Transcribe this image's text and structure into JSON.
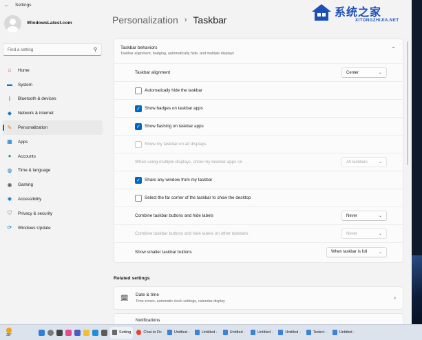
{
  "window": {
    "title": "Settings"
  },
  "profile": {
    "name": "WindowsLatest.com",
    "subtitle": ""
  },
  "search": {
    "placeholder": "Find a setting"
  },
  "nav": [
    {
      "label": "Home",
      "icon": "home-icon",
      "color": "#c0392b"
    },
    {
      "label": "System",
      "icon": "system-icon",
      "color": "#0078d4"
    },
    {
      "label": "Bluetooth & devices",
      "icon": "bluetooth-icon",
      "color": "#0078d4"
    },
    {
      "label": "Network & internet",
      "icon": "wifi-icon",
      "color": "#0078d4"
    },
    {
      "label": "Personalization",
      "icon": "brush-icon",
      "color": "#e07a14",
      "active": true
    },
    {
      "label": "Apps",
      "icon": "apps-icon",
      "color": "#0078d4"
    },
    {
      "label": "Accounts",
      "icon": "person-icon",
      "color": "#2aa05a"
    },
    {
      "label": "Time & language",
      "icon": "globe-icon",
      "color": "#0078d4"
    },
    {
      "label": "Gaming",
      "icon": "gamepad-icon",
      "color": "#555555"
    },
    {
      "label": "Accessibility",
      "icon": "accessibility-icon",
      "color": "#0078d4"
    },
    {
      "label": "Privacy & security",
      "icon": "shield-icon",
      "color": "#6b6b6b"
    },
    {
      "label": "Windows Update",
      "icon": "update-icon",
      "color": "#0078d4"
    }
  ],
  "header": {
    "crumb1": "Personalization",
    "separator": "›",
    "crumb2": "Taskbar"
  },
  "behaviors": {
    "title": "Taskbar behaviors",
    "subtitle": "Taskbar alignment, badging, automatically hide, and multiple displays",
    "alignment": {
      "label": "Taskbar alignment",
      "value": "Center"
    },
    "auto_hide": {
      "label": "Automatically hide the taskbar",
      "checked": false
    },
    "badges": {
      "label": "Show badges on taskbar apps",
      "checked": true
    },
    "flashing": {
      "label": "Show flashing on taskbar apps",
      "checked": true
    },
    "all_displays": {
      "label": "Show my taskbar on all displays",
      "checked": false,
      "disabled": true
    },
    "multi_display": {
      "label": "When using multiple displays, show my taskbar apps on",
      "value": "All taskbars"
    },
    "share_window": {
      "label": "Share any window from my taskbar",
      "checked": true
    },
    "far_corner": {
      "label": "Select the far corner of the taskbar to show the desktop",
      "checked": false
    },
    "combine": {
      "label": "Combine taskbar buttons and hide labels",
      "value": "Never"
    },
    "combine_other": {
      "label": "Combine taskbar buttons and hide labels on other taskbars",
      "value": "Never"
    },
    "smaller": {
      "label": "Show smaller taskbar buttons",
      "value": "When taskbar is full"
    }
  },
  "related": {
    "heading": "Related settings",
    "date_time": {
      "title": "Date & time",
      "subtitle": "Time zones, automatic clock settings, calendar display"
    },
    "notifications": {
      "title": "Notifications"
    }
  },
  "watermark": {
    "text": "系统之家",
    "url": "XITONGZHIJIA.NET"
  },
  "taskbar": {
    "weather": "28°",
    "apps": [
      "Setting",
      "Chat to Dc",
      "Untitled -",
      "Untitled -",
      "Untitled -",
      "Untitled -",
      "Untitled -",
      "Textrct -",
      "Untitled -"
    ]
  },
  "colors": {
    "accent": "#0067c0",
    "watermark": "#1d4fb8"
  }
}
